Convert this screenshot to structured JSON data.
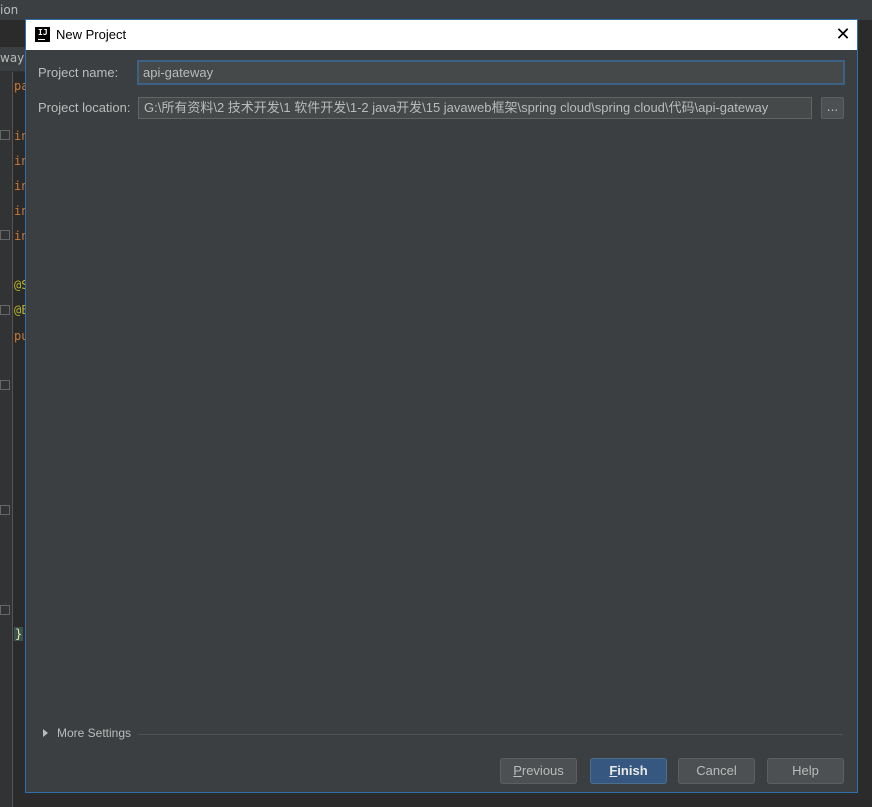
{
  "ide": {
    "menu_fragment": "ion",
    "tab_fragment": "way",
    "code_fragments": [
      "pa",
      "in",
      "in",
      "in",
      "in",
      "in",
      "@S",
      "@E",
      "pu",
      "}"
    ]
  },
  "dialog": {
    "title": "New Project",
    "logo_text": "IJ",
    "close_glyph": "✕",
    "project_name_label": "Project name:",
    "project_name_value": "api-gateway",
    "project_location_label": "Project location:",
    "project_location_value": "G:\\所有资料\\2 技术开发\\1 软件开发\\1-2 java开发\\15 javaweb框架\\spring cloud\\spring cloud\\代码\\api-gateway",
    "browse_label": "...",
    "more_settings_label": "More Settings",
    "buttons": {
      "previous": {
        "first": "P",
        "rest": "revious"
      },
      "finish": {
        "first": "F",
        "rest": "inish"
      },
      "cancel": "Cancel",
      "help": "Help"
    }
  },
  "colors": {
    "accent": "#365880",
    "dialog_bg": "#3c3f41",
    "focus_border": "#3d6185"
  }
}
